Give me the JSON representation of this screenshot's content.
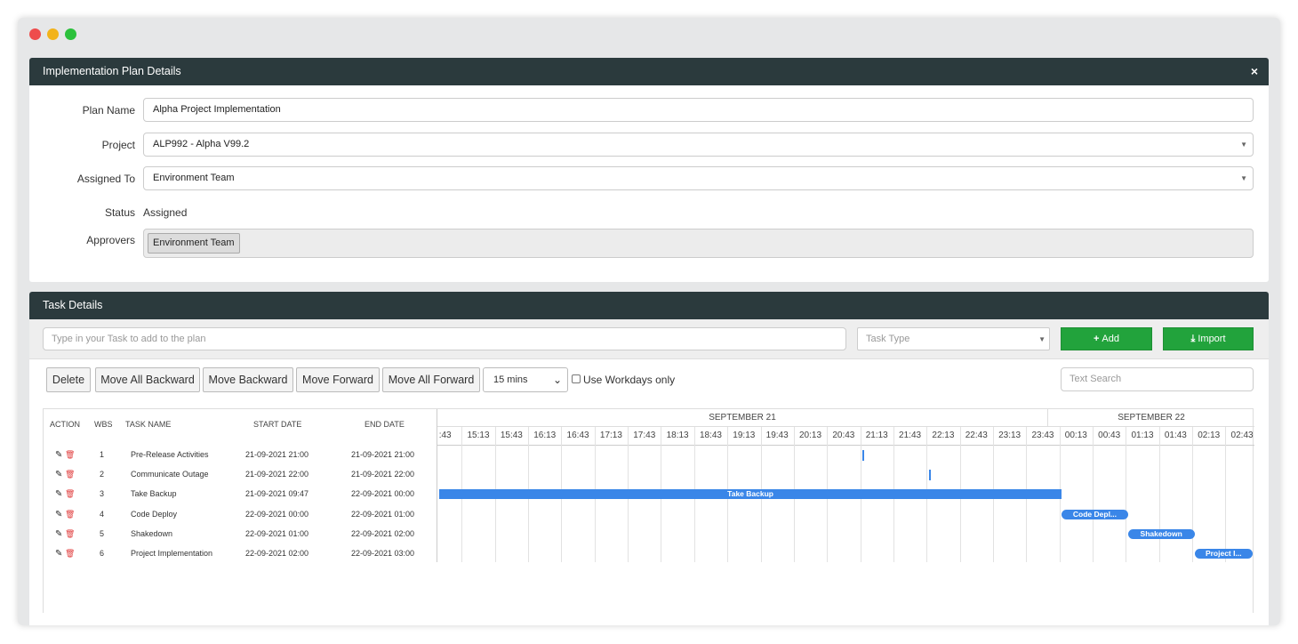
{
  "window": {
    "controls": [
      "close",
      "minimize",
      "maximize"
    ]
  },
  "plan_panel": {
    "title": "Implementation Plan Details",
    "close_label": "×",
    "fields": {
      "plan_name": {
        "label": "Plan Name",
        "value": "Alpha Project Implementation"
      },
      "project": {
        "label": "Project",
        "value": "ALP992 - Alpha V99.2"
      },
      "assigned_to": {
        "label": "Assigned To",
        "value": "Environment Team"
      },
      "status": {
        "label": "Status",
        "value": "Assigned"
      },
      "approvers": {
        "label": "Approvers",
        "values": [
          "Environment Team"
        ]
      }
    }
  },
  "task_panel": {
    "title": "Task Details",
    "task_input_placeholder": "Type in your Task to add to the plan",
    "task_type_placeholder": "Task Type",
    "add_label": "Add",
    "import_label": "Import",
    "buttons": {
      "delete": "Delete",
      "move_all_backward": "Move All Backward",
      "move_backward": "Move Backward",
      "move_forward": "Move Forward",
      "move_all_forward": "Move All Forward"
    },
    "interval": "15 mins",
    "workdays_label": "Use Workdays only",
    "text_search_placeholder": "Text Search",
    "columns": [
      "ACTION",
      "WBS",
      "TASK NAME",
      "START DATE",
      "END DATE"
    ],
    "tasks": [
      {
        "wbs": "1",
        "name": "Pre-Release Activities",
        "start": "21-09-2021 21:00",
        "end": "21-09-2021 21:00"
      },
      {
        "wbs": "2",
        "name": "Communicate Outage",
        "start": "21-09-2021 22:00",
        "end": "21-09-2021 22:00"
      },
      {
        "wbs": "3",
        "name": "Take Backup",
        "start": "21-09-2021 09:47",
        "end": "22-09-2021 00:00"
      },
      {
        "wbs": "4",
        "name": "Code Deploy",
        "start": "22-09-2021 00:00",
        "end": "22-09-2021 01:00"
      },
      {
        "wbs": "5",
        "name": "Shakedown",
        "start": "22-09-2021 01:00",
        "end": "22-09-2021 02:00"
      },
      {
        "wbs": "6",
        "name": "Project Implementation",
        "start": "22-09-2021 02:00",
        "end": "22-09-2021 03:00"
      }
    ],
    "gantt": {
      "months": [
        "SEPTEMBER 21",
        "SEPTEMBER 22"
      ],
      "hours": [
        ":43",
        "15:13",
        "15:43",
        "16:13",
        "16:43",
        "17:13",
        "17:43",
        "18:13",
        "18:43",
        "19:13",
        "19:43",
        "20:13",
        "20:43",
        "21:13",
        "21:43",
        "22:13",
        "22:43",
        "23:13",
        "23:43",
        "00:13",
        "00:43",
        "01:13",
        "01:43",
        "02:13",
        "02:43"
      ],
      "bar_labels": [
        "",
        "",
        "Take Backup",
        "Code Depl...",
        "Shakedown",
        "Project I..."
      ],
      "bar_color": "#3a86e8"
    }
  },
  "colors": {
    "header_bg": "#2b3a3d",
    "green_button": "#22a33c",
    "delete_icon": "#e03c3c"
  }
}
